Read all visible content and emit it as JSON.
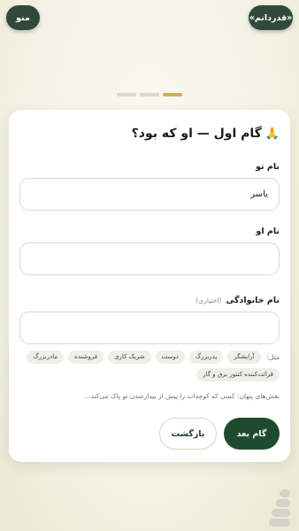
{
  "header": {
    "thanks_label": "«قدردانم»",
    "menu_label": "منو"
  },
  "progress": {
    "total_steps": 3,
    "current_step": 1
  },
  "card": {
    "title": "گام اول — او که بود؟",
    "title_emoji": "🙏",
    "your_name": {
      "label": "نام تو",
      "value": "یاسر",
      "placeholder": ""
    },
    "their_name": {
      "label": "نام او",
      "value": "",
      "placeholder": ""
    },
    "family_name": {
      "label": "نام خانوادگی",
      "optional": "(اختیاری)",
      "value": "",
      "placeholder": ""
    },
    "examples": {
      "label": "مثل:",
      "chips": [
        "آرایشگر",
        "پدربزرگ",
        "دوست",
        "شریک کاری",
        "فروشنده",
        "مادربزرگ",
        "قرائت‌کننده کنتور برق و گاز"
      ]
    },
    "hint": "نقش‌های پنهان: کسی که کوچه‌ات را پیش از بیدارشدن تو پاک می‌کند...",
    "next_label": "گام بعد",
    "back_label": "بازگشت"
  },
  "colors": {
    "accent": "#1f4a30",
    "header_button": "#2f4a3c",
    "step_active": "#d0ae58"
  },
  "icons": {
    "logo": "app-logo-icon",
    "title_emoji": "praying-hands-icon"
  }
}
